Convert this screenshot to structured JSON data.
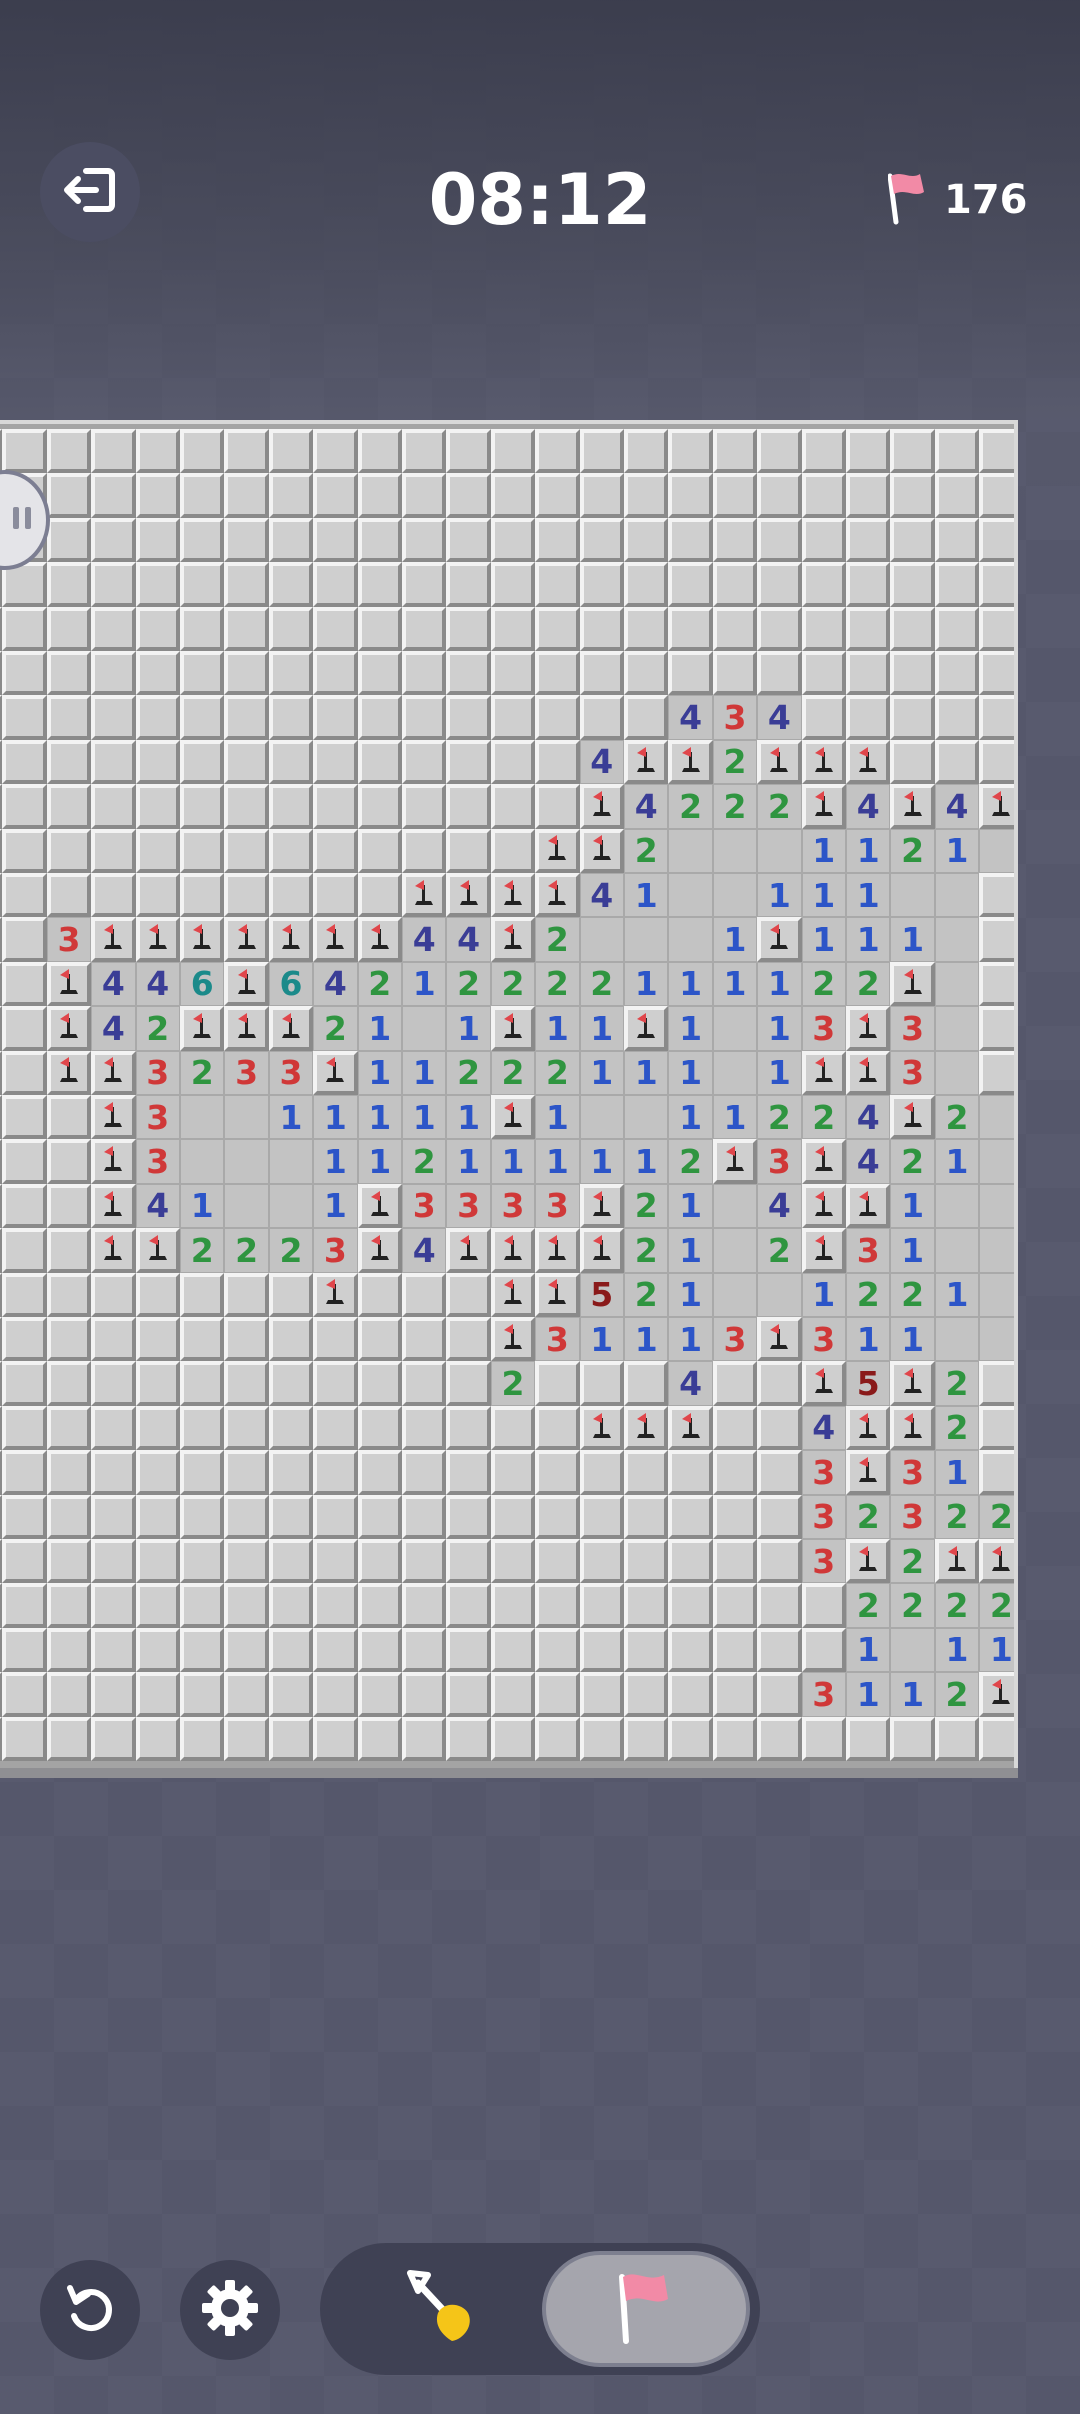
{
  "header": {
    "timer": "08:12",
    "flags_remaining": "176",
    "exit_icon": "exit-icon",
    "flag_icon": "flag-icon"
  },
  "board": {
    "cols": 24,
    "rows": 30,
    "legend": "# = closed, F = flag, . = opened empty, 1-8 = number",
    "rows_data": [
      "########################",
      "########################",
      "########################",
      "########################",
      "########################",
      "########################",
      "################434#####",
      "##############4FF2FFF###",
      "##############F4222F4F4F",
      "#############FF2...1121.",
      "##########FFFF41..111..#",
      "##3FFFFFFF44F2...1F111.#",
      "##F446F64212222111122F.#",
      "##F42FFF21.1F11F1.13F3.#",
      "##FF3233F11222111.1FF3.#",
      "###F3..11111F1..11224F2.",
      "###F3...112111112F3F421.",
      "###F41..1F3333F21.4FF1..",
      "###FF2223F4FFFF21.2F31..",
      "########F###FF521..1221.",
      "############F31113F311..",
      "############2###4##F5F2#",
      "##############FFF##4FF2#",
      "###################3F31#",
      "###################32322",
      "###################3F2FF",
      "####################2222",
      "####################1.11",
      "###################3112F",
      "########################"
    ]
  },
  "side_handle_icon": "pause-icon",
  "controls": {
    "undo_icon": "undo-icon",
    "settings_icon": "gear-icon",
    "dig_mode_icon": "shovel-icon",
    "flag_mode_icon": "flag-icon",
    "active_mode": "flag"
  },
  "colors": {
    "background": "#585a6e",
    "num1": "#2c55c8",
    "num2": "#2f9540",
    "num3": "#d03838",
    "num4": "#3a3d96",
    "num5": "#8a1a1a",
    "num6": "#1b8a8a",
    "flag": "#e0464b",
    "flag_mode_pink": "#f28aa6",
    "shovel_yellow": "#f5c518"
  }
}
